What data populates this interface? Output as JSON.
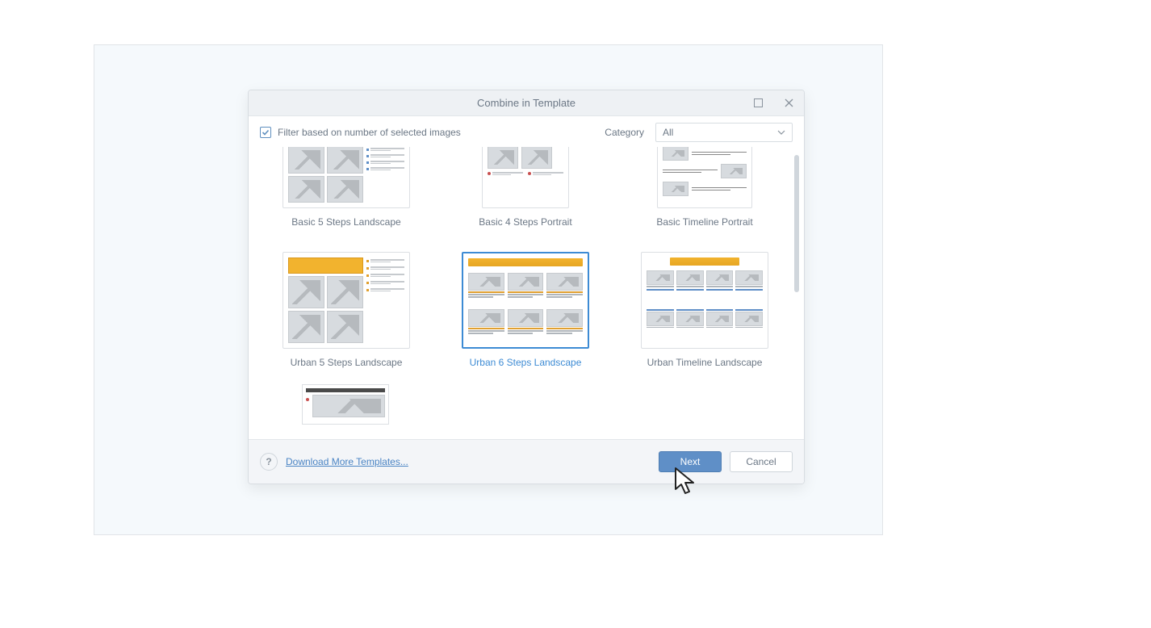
{
  "dialog": {
    "title": "Combine in Template"
  },
  "toolbar": {
    "filter_label": "Filter based on number of selected images",
    "filter_checked": true,
    "category_label": "Category",
    "category_value": "All"
  },
  "templates": {
    "row1": [
      {
        "label": "Basic 5 Steps Landscape",
        "selected": false
      },
      {
        "label": "Basic 4 Steps Portrait",
        "selected": false
      },
      {
        "label": "Basic Timeline Portrait",
        "selected": false
      }
    ],
    "row2": [
      {
        "label": "Urban 5 Steps Landscape",
        "selected": false
      },
      {
        "label": "Urban 6 Steps Landscape",
        "selected": true
      },
      {
        "label": "Urban Timeline Landscape",
        "selected": false
      }
    ]
  },
  "footer": {
    "download_label": "Download More Templates...",
    "next_label": "Next",
    "cancel_label": "Cancel",
    "help_label": "?"
  }
}
